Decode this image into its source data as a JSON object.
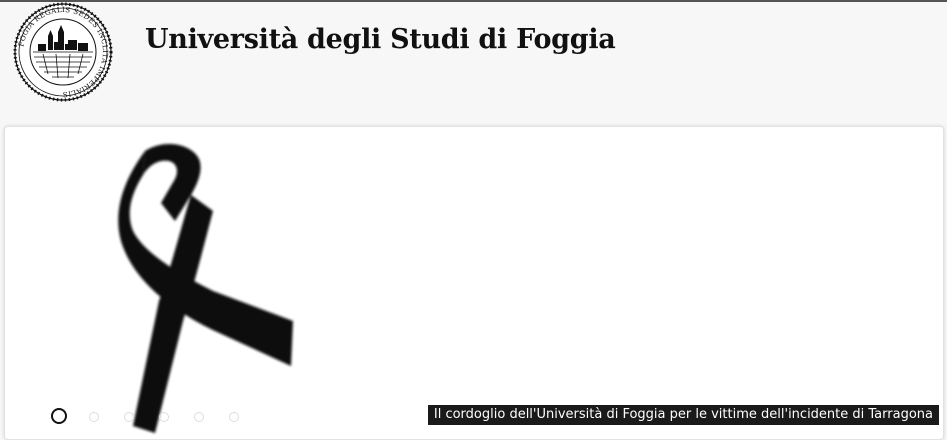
{
  "header": {
    "seal_text": "FOGIA REGALIS SEDES INCLITA IMPERIALIS",
    "title": "Università degli Studi di Foggia"
  },
  "slider": {
    "slide_count": 6,
    "active_index": 0,
    "image_icon": "black-ribbon-icon",
    "caption": "Il cordoglio dell'Università di Foggia per le vittime dell'incidente di Tarragona"
  },
  "colors": {
    "background": "#f7f7f7",
    "panel": "#ffffff",
    "caption_bg": "#1a1a1a",
    "caption_text": "#ffffff",
    "ribbon": "#0d0d0d"
  }
}
